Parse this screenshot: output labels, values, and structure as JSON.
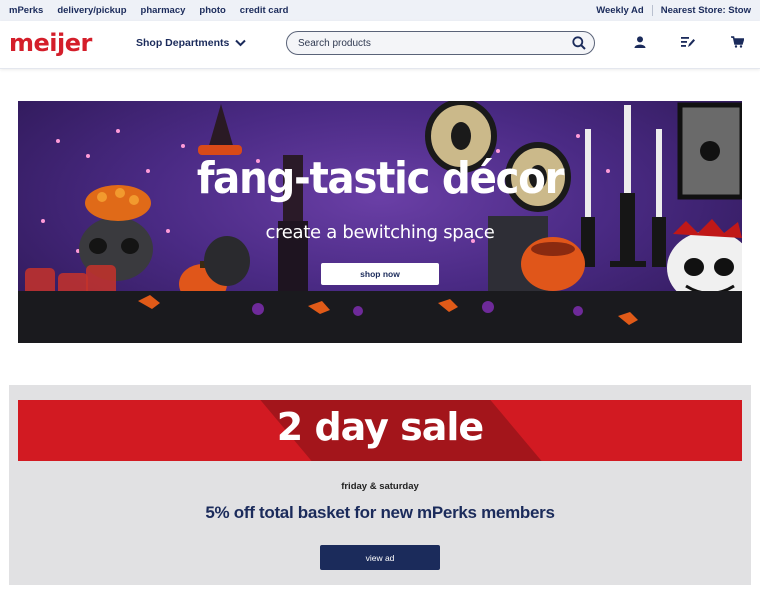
{
  "utility": {
    "links": [
      "mPerks",
      "delivery/pickup",
      "pharmacy",
      "photo",
      "credit card"
    ],
    "weekly_ad": "Weekly Ad",
    "nearest_store": "Nearest Store: Stow"
  },
  "header": {
    "logo": "meijer",
    "shop_departments": "Shop Departments",
    "search_placeholder": "Search products",
    "icons": [
      "search-icon",
      "account-icon",
      "list-icon",
      "cart-icon"
    ]
  },
  "hero": {
    "headline": "fang-tastic décor",
    "subline": "create a bewitching space",
    "cta": "shop now"
  },
  "sale": {
    "banner": "2 day sale",
    "when": "friday & saturday",
    "offer": "5% off total basket for new mPerks members",
    "cta": "view ad"
  },
  "colors": {
    "brand_red": "#d41e2a",
    "navy": "#1b2b5b",
    "sale_red": "#d21a22",
    "panel_gray": "#e1e1e3"
  }
}
